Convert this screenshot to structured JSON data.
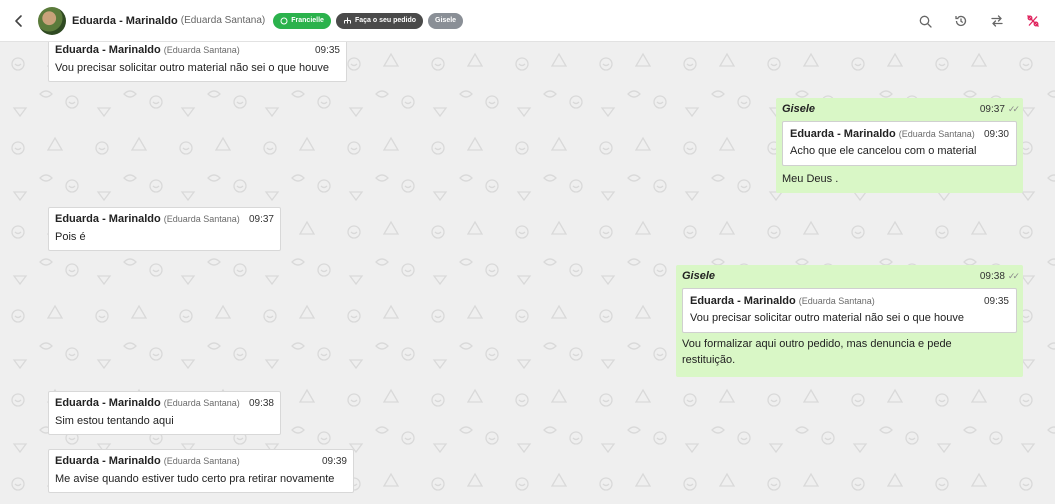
{
  "header": {
    "contact_name": "Eduarda - Marinaldo",
    "contact_sub": "(Eduarda Santana)",
    "tags": [
      {
        "label": "Francielle",
        "icon": "whatsapp-icon",
        "color": "#2bb24c"
      },
      {
        "label": "Faça o seu pedido",
        "icon": "sitemap-icon",
        "color": "#4a4a4a"
      },
      {
        "label": "Gisele",
        "color": "#8a8f96"
      }
    ],
    "actions": [
      "search-icon",
      "history-icon",
      "transfer-icon",
      "percent-off-icon"
    ]
  },
  "messages": [
    {
      "sender": "Eduarda - Marinaldo",
      "sender_sub": "(Eduarda Santana)",
      "time": "09:35",
      "text": "Vou precisar solicitar outro material não sei o que houve"
    },
    {
      "sender": "Gisele",
      "time": "09:37",
      "quote": {
        "sender": "Eduarda - Marinaldo",
        "sender_sub": "(Eduarda Santana)",
        "time": "09:30",
        "text": "Acho que ele cancelou com o material"
      },
      "text": "Meu Deus ."
    },
    {
      "sender": "Eduarda - Marinaldo",
      "sender_sub": "(Eduarda Santana)",
      "time": "09:37",
      "text": "Pois é"
    },
    {
      "sender": "Gisele",
      "time": "09:38",
      "quote": {
        "sender": "Eduarda - Marinaldo",
        "sender_sub": "(Eduarda Santana)",
        "time": "09:35",
        "text": "Vou precisar solicitar outro material não sei o que houve"
      },
      "text_line1": "Vou formalizar aqui outro pedido, mas denuncia e pede",
      "text_line2": "restituição."
    },
    {
      "sender": "Eduarda - Marinaldo",
      "sender_sub": "(Eduarda Santana)",
      "time": "09:38",
      "text": "Sim estou tentando aqui"
    },
    {
      "sender": "Eduarda - Marinaldo",
      "sender_sub": "(Eduarda Santana)",
      "time": "09:39",
      "text": "Me avise quando estiver tudo certo pra retirar novamente"
    }
  ],
  "colors": {
    "outgoing_bubble": "#d9f7c6",
    "incoming_bubble": "#ffffff",
    "background": "#efefef",
    "accent_red": "#e0245e"
  }
}
